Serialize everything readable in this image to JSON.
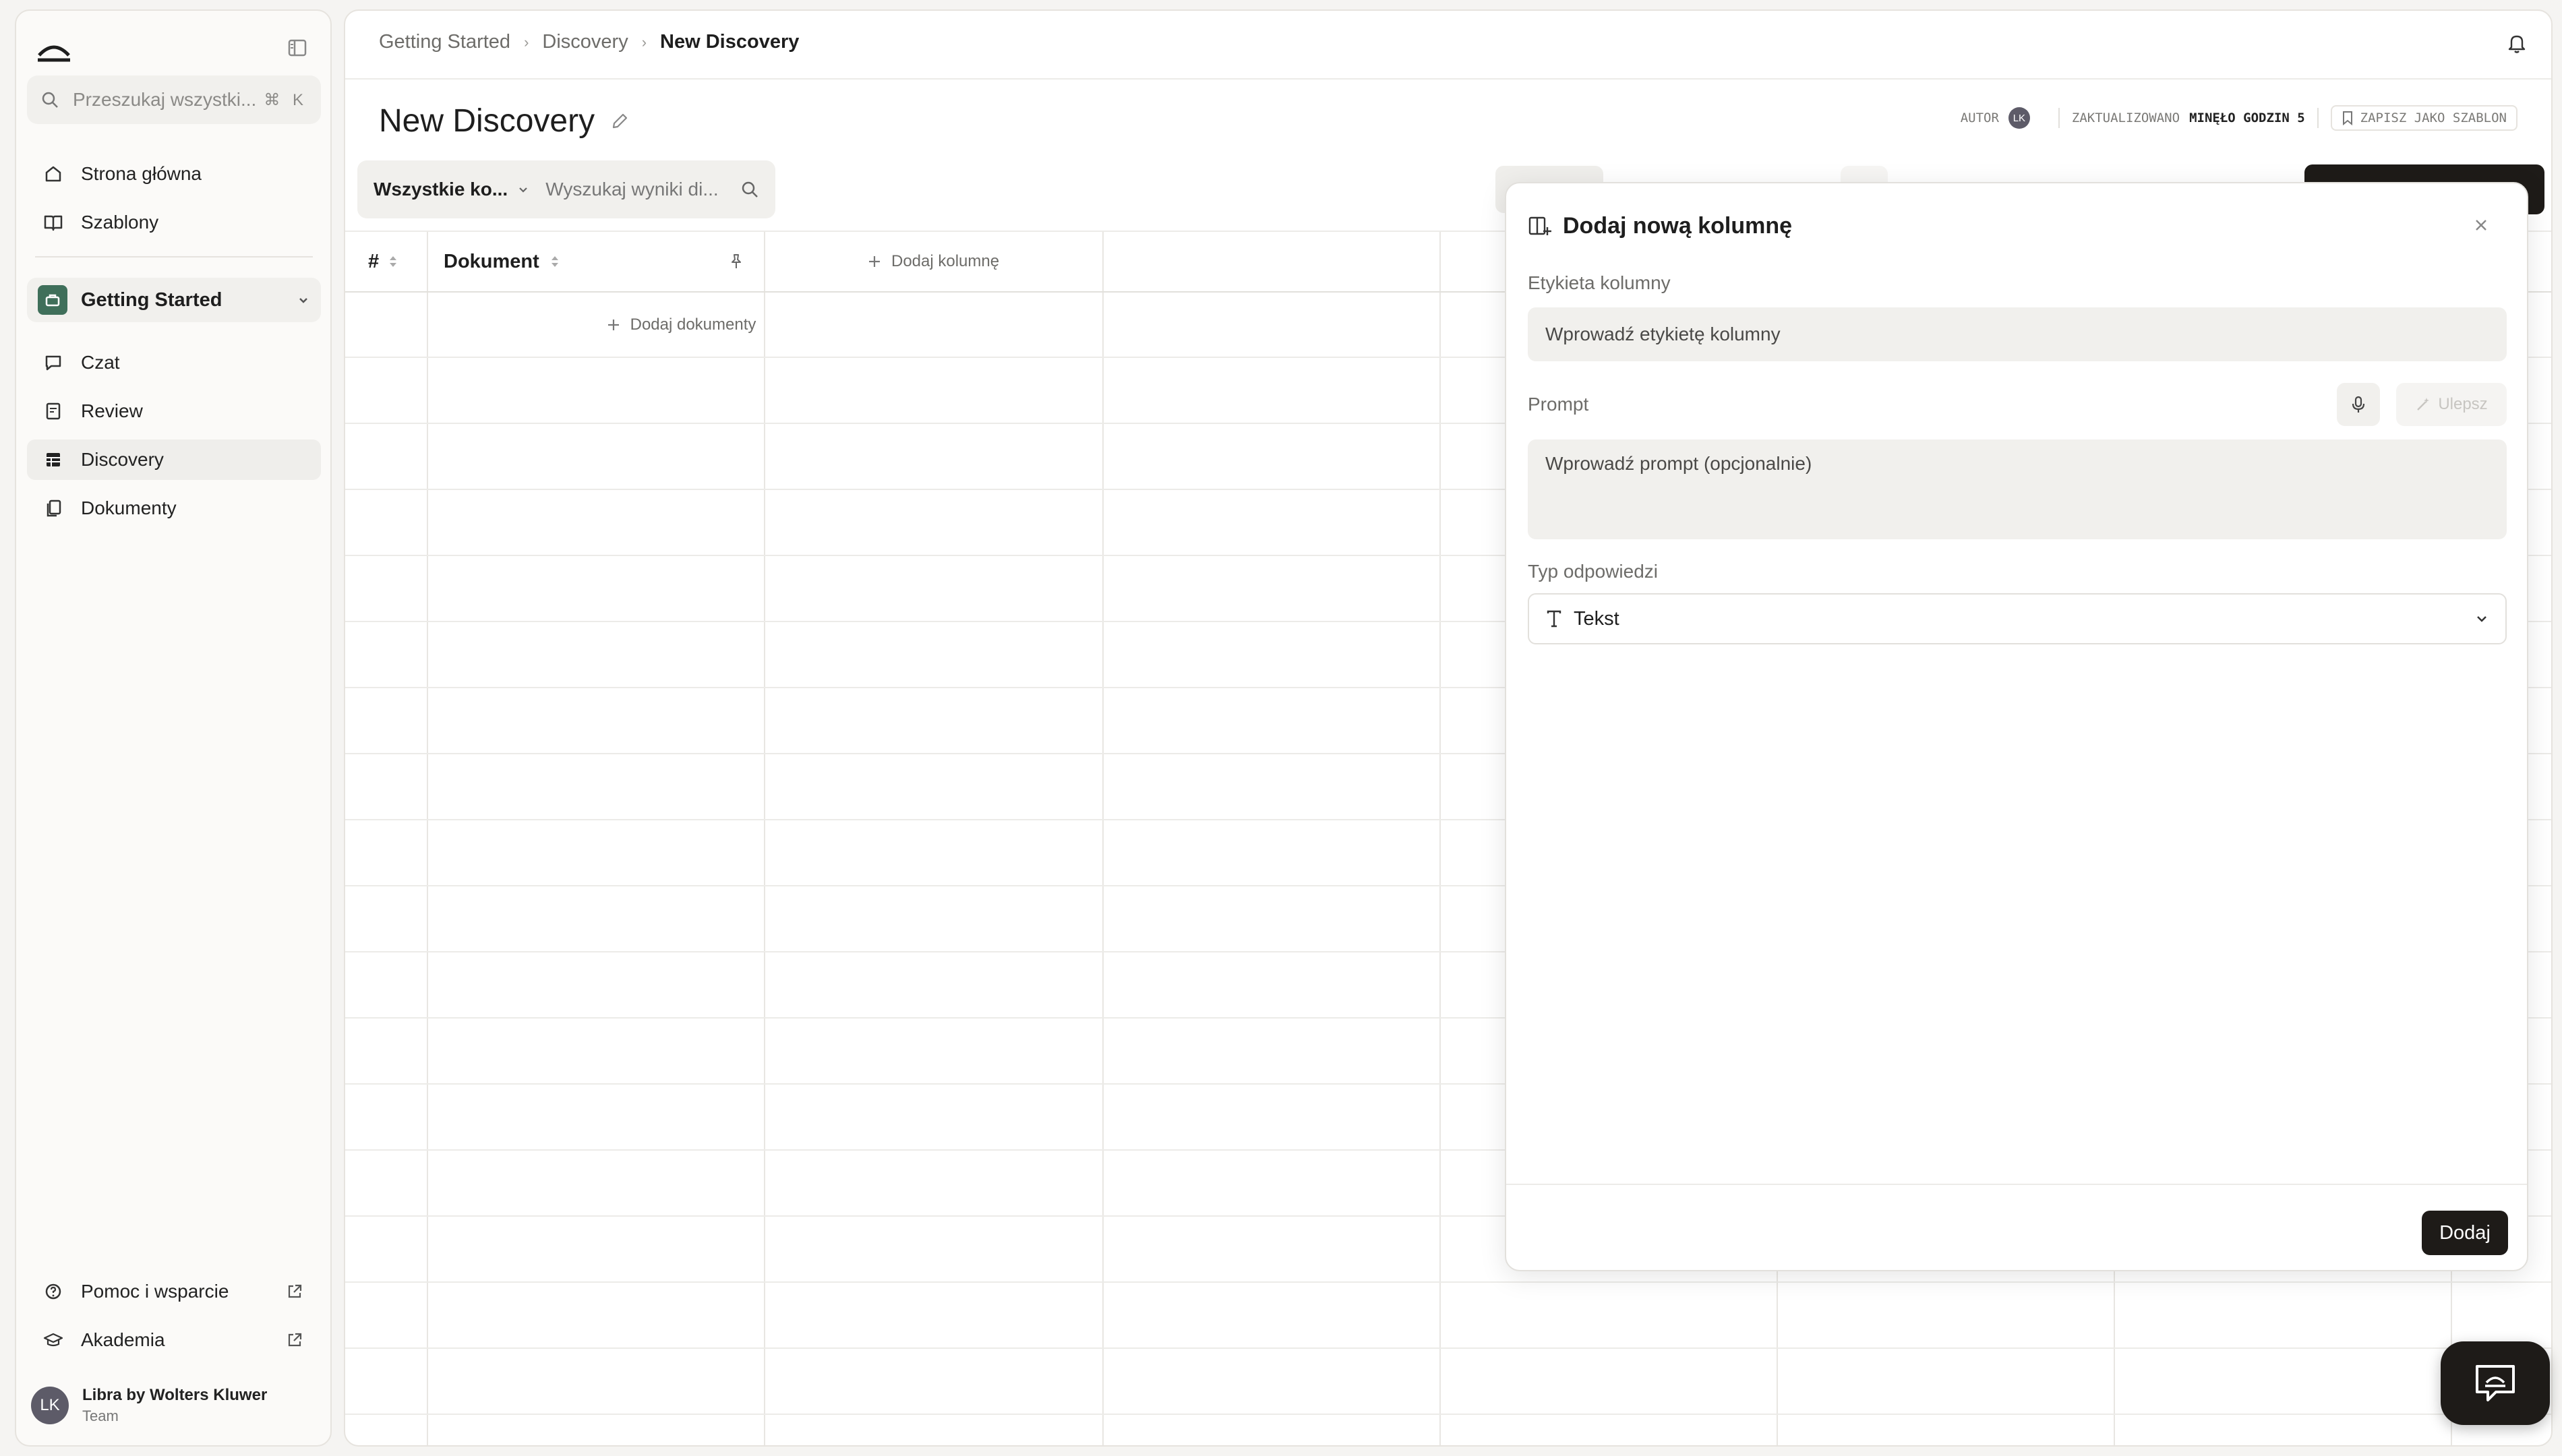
{
  "sidebar": {
    "search_placeholder": "Przeszukaj wszystki...",
    "search_shortcut": "⌘ K",
    "nav": [
      {
        "label": "Strona główna",
        "icon": "home-icon"
      },
      {
        "label": "Szablony",
        "icon": "book-icon"
      }
    ],
    "project": {
      "name": "Getting Started"
    },
    "project_nav": [
      {
        "label": "Czat",
        "icon": "chat-icon"
      },
      {
        "label": "Review",
        "icon": "review-icon"
      },
      {
        "label": "Discovery",
        "icon": "table-icon",
        "active": true
      },
      {
        "label": "Dokumenty",
        "icon": "documents-icon"
      }
    ],
    "footer_nav": [
      {
        "label": "Pomoc i wsparcie",
        "icon": "help-icon"
      },
      {
        "label": "Akademia",
        "icon": "graduation-cap-icon"
      }
    ],
    "user": {
      "initials": "LK",
      "name": "Libra by Wolters Kluwer",
      "team": "Team"
    }
  },
  "breadcrumb": [
    "Getting Started",
    "Discovery",
    "New Discovery"
  ],
  "page": {
    "title": "New Discovery",
    "meta": {
      "author_label": "AUTOR",
      "author_initials": "LK",
      "updated_label": "ZAKTUALIZOWANO",
      "updated_value": "MINĘŁO GODZIN 5",
      "save_template": "ZAPISZ JAKO SZABLON"
    }
  },
  "filters": {
    "column_select": "Wszystkie ko...",
    "search_placeholder": "Wyszukaj wyniki di..."
  },
  "grid": {
    "headers": {
      "index": "#",
      "document": "Dokument",
      "add_column": "Dodaj kolumnę"
    },
    "add_documents": "Dodaj dokumenty"
  },
  "modal": {
    "title": "Dodaj nową kolumnę",
    "label_field": {
      "label": "Etykieta kolumny",
      "placeholder": "Wprowadź etykietę kolumny"
    },
    "prompt_field": {
      "label": "Prompt",
      "placeholder": "Wprowadź prompt (opcjonalnie)",
      "improve_label": "Ulepsz"
    },
    "response_type": {
      "label": "Typ odpowiedzi",
      "value": "Tekst"
    },
    "submit": "Dodaj"
  }
}
